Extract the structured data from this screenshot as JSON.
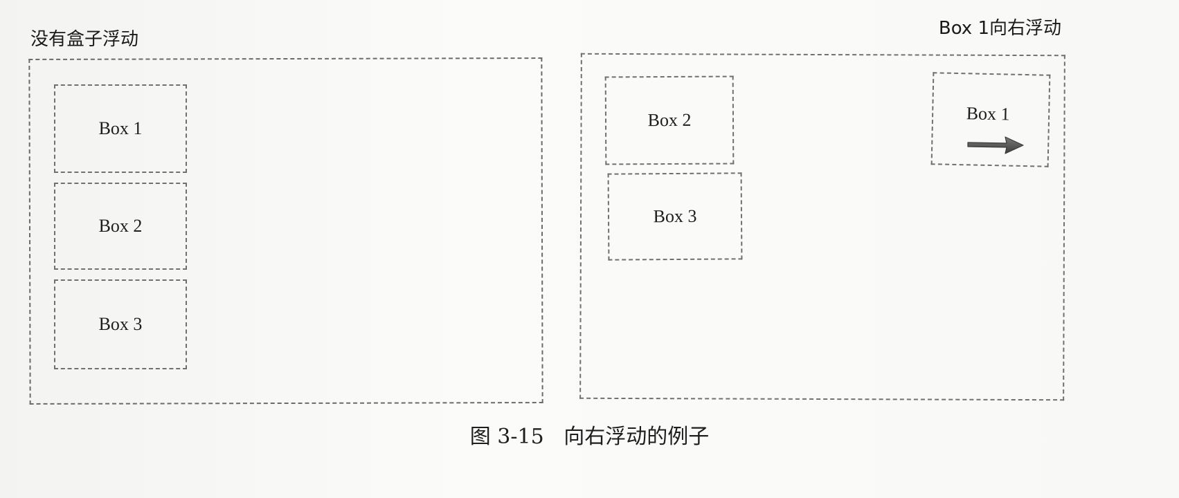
{
  "panels": {
    "left": {
      "title": "没有盒子浮动",
      "boxes": [
        "Box 1",
        "Box 2",
        "Box 3"
      ]
    },
    "right": {
      "title": "Box 1向右浮动",
      "boxes": [
        "Box 2",
        "Box 3",
        "Box 1"
      ],
      "arrow_icon": "right-arrow-icon"
    }
  },
  "caption": "图 3-15   向右浮动的例子",
  "colors": {
    "border": "#6a6a6a",
    "text": "#1d1d1d",
    "arrow": "#555555"
  }
}
